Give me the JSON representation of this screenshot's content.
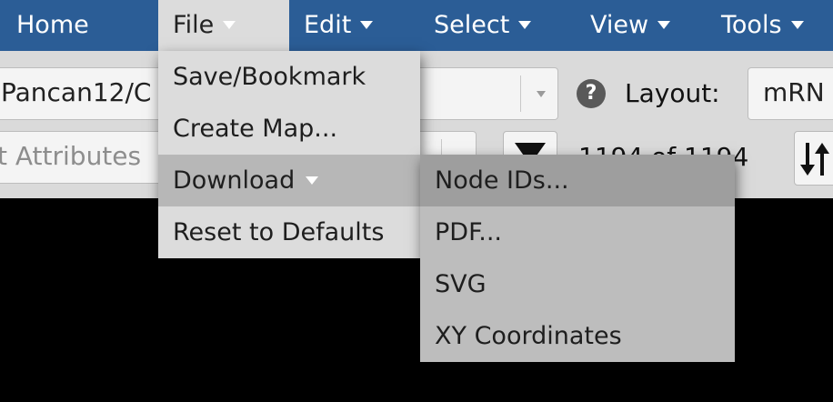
{
  "nav": {
    "items": [
      {
        "label": "Home"
      },
      {
        "label": "File"
      },
      {
        "label": "Edit"
      },
      {
        "label": "Select"
      },
      {
        "label": "View"
      },
      {
        "label": "Tools"
      }
    ]
  },
  "toolbar": {
    "map_select": {
      "value": "Pancan12/C"
    },
    "help_icon": "?",
    "layout_label": "Layout:",
    "layout_select": {
      "value": "mRN"
    },
    "attributes_search": {
      "placeholder": "t Attributes"
    },
    "count_text": "1194 of 1194"
  },
  "file_menu": {
    "items": [
      {
        "label": "Save/Bookmark"
      },
      {
        "label": "Create Map..."
      },
      {
        "label": "Download"
      },
      {
        "label": "Reset to Defaults"
      }
    ]
  },
  "download_submenu": {
    "items": [
      {
        "label": "Node IDs..."
      },
      {
        "label": "PDF..."
      },
      {
        "label": "SVG"
      },
      {
        "label": "XY Coordinates"
      }
    ]
  },
  "colors": {
    "navbar": "#2b5d96",
    "menu_bg": "#dcdcdc",
    "menu_highlight": "#b7b7b7",
    "submenu_bg": "#bdbdbd",
    "submenu_highlight": "#9e9e9e"
  }
}
